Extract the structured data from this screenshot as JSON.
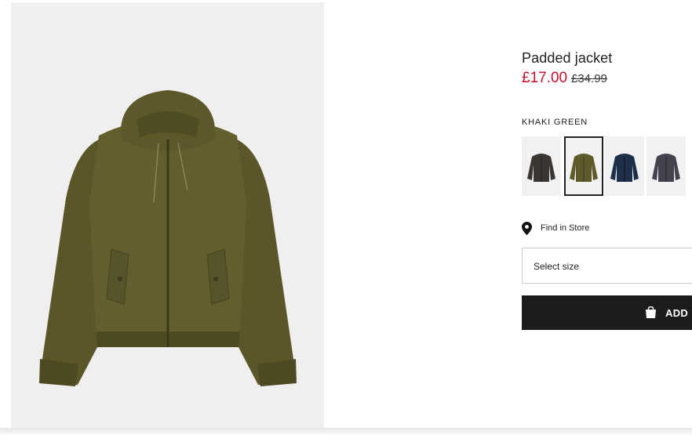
{
  "product": {
    "title": "Padded jacket",
    "price_sale": "£17.00",
    "price_original": "£34.99",
    "colors": {
      "sale": "#c8102e",
      "image_background": "#efefef",
      "jacket_main": "#5e5a2a",
      "button_background": "#1c1c1c"
    }
  },
  "color_selector": {
    "selected_color_name": "KHAKI GREEN",
    "swatches": [
      {
        "color": "#3a3632",
        "selected": false
      },
      {
        "color": "#5e5a2a",
        "selected": true
      },
      {
        "color": "#1e2f4a",
        "selected": false
      },
      {
        "color": "#44424e",
        "selected": false
      }
    ]
  },
  "store": {
    "label": "Find in Store",
    "icon": "location-pin-icon"
  },
  "size_select": {
    "label": "Select size"
  },
  "add_button": {
    "label": "ADD",
    "icon": "shopping-bag-icon"
  }
}
